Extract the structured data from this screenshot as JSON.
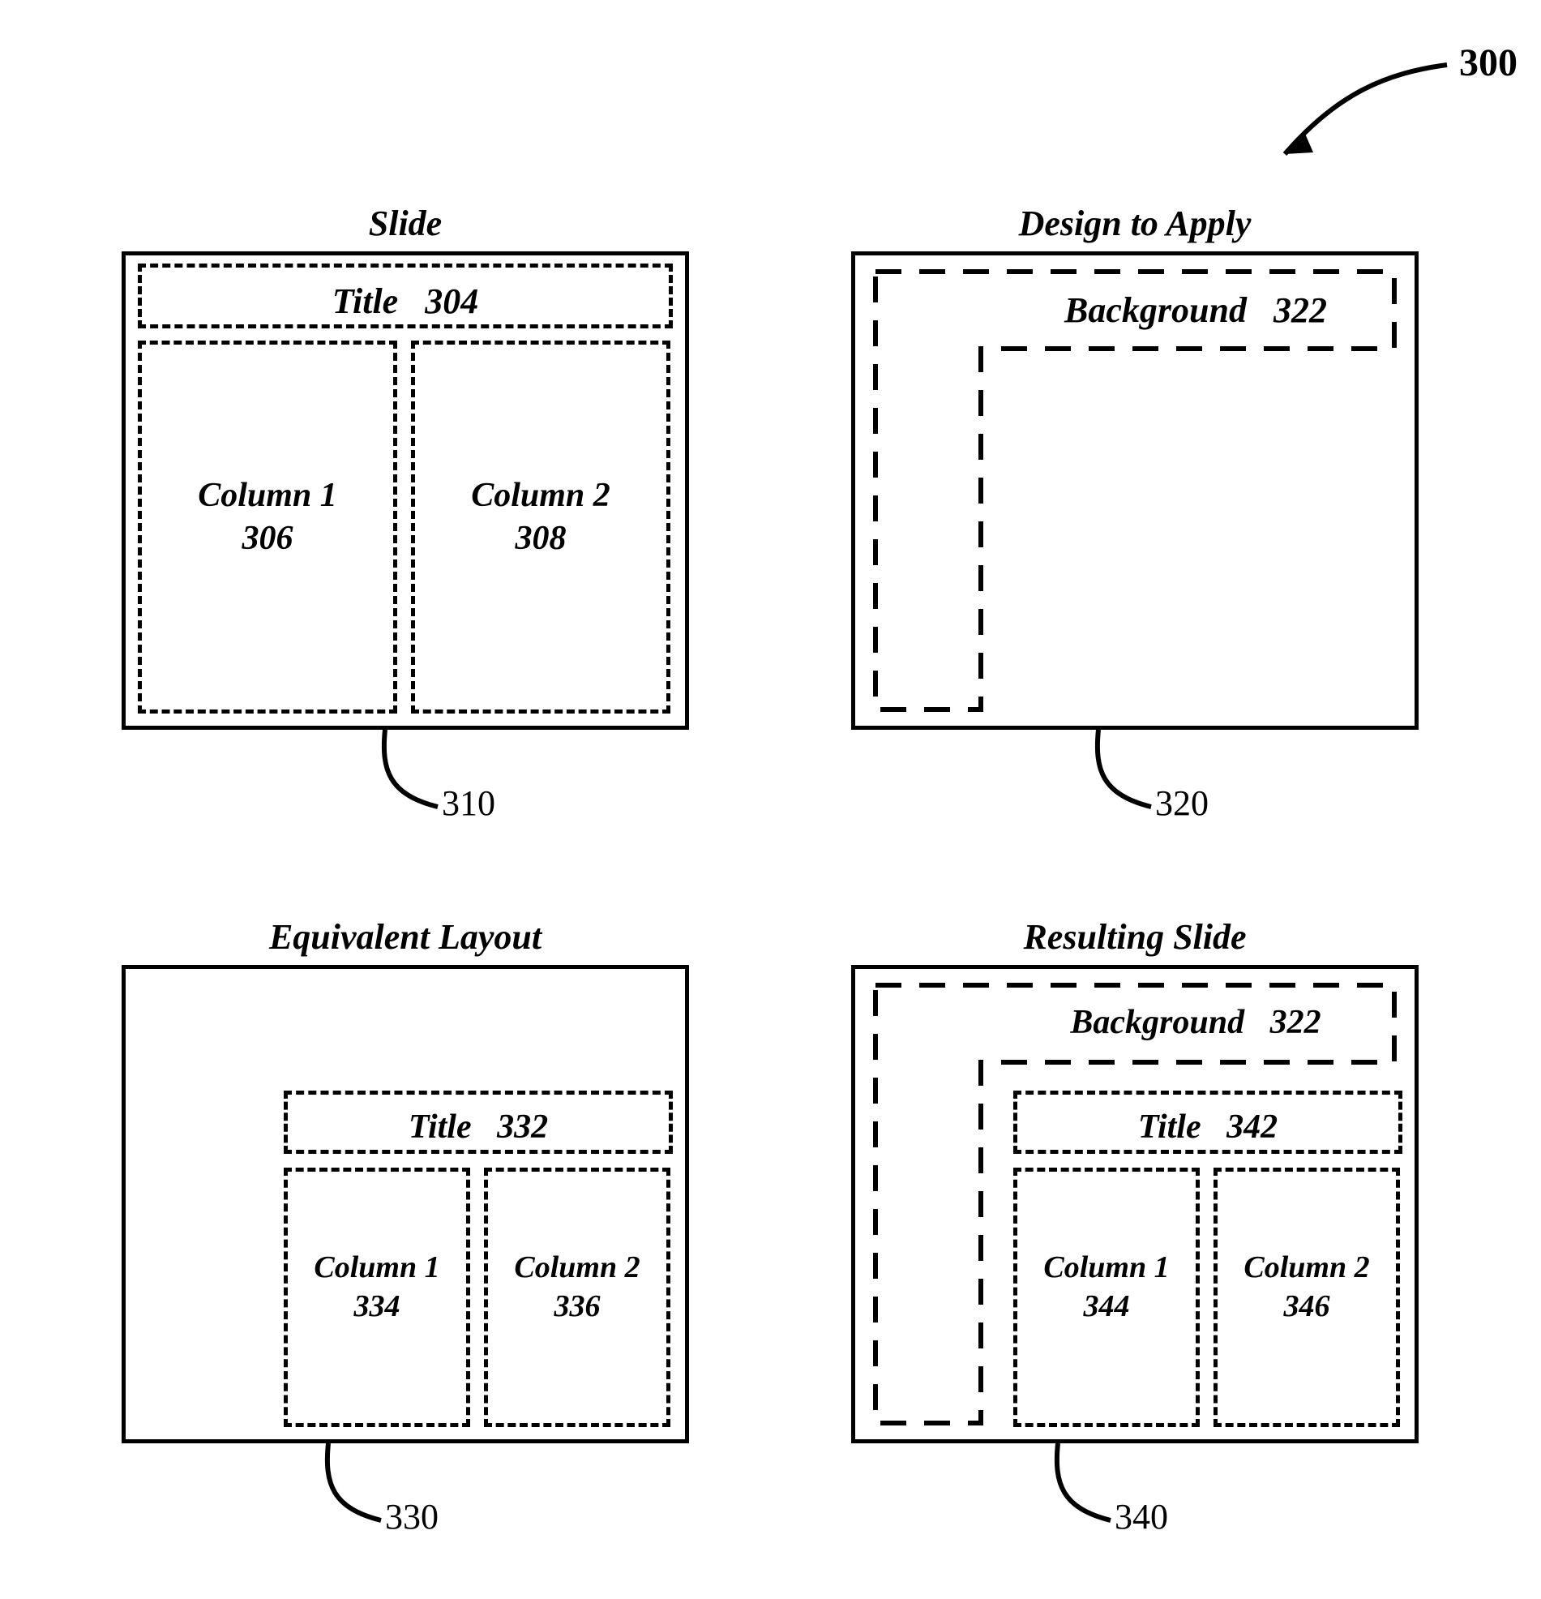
{
  "figure_number": "300",
  "panels": {
    "slide": {
      "title": "Slide",
      "title_region": {
        "label": "Title",
        "ref": "304"
      },
      "col1": {
        "label": "Column 1",
        "ref": "306"
      },
      "col2": {
        "label": "Column 2",
        "ref": "308"
      },
      "ref": "310"
    },
    "design": {
      "title": "Design to Apply",
      "background": {
        "label": "Background",
        "ref": "322"
      },
      "ref": "320"
    },
    "equivalent": {
      "title": "Equivalent Layout",
      "title_region": {
        "label": "Title",
        "ref": "332"
      },
      "col1": {
        "label": "Column 1",
        "ref": "334"
      },
      "col2": {
        "label": "Column 2",
        "ref": "336"
      },
      "ref": "330"
    },
    "resulting": {
      "title": "Resulting Slide",
      "background": {
        "label": "Background",
        "ref": "322"
      },
      "title_region": {
        "label": "Title",
        "ref": "342"
      },
      "col1": {
        "label": "Column 1",
        "ref": "344"
      },
      "col2": {
        "label": "Column 2",
        "ref": "346"
      },
      "ref": "340"
    }
  }
}
